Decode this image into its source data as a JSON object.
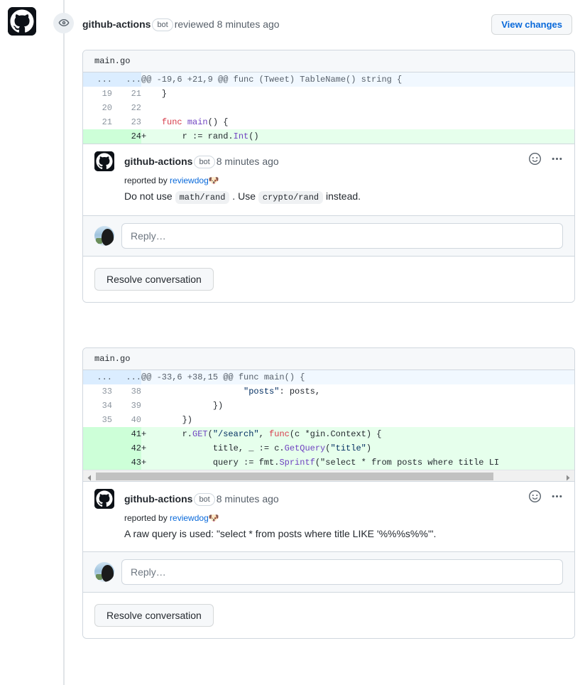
{
  "header": {
    "org_avatar_icon": "github-mark-icon",
    "state_icon": "eye-icon",
    "actor": "github-actions",
    "bot_badge": "bot",
    "action_text": "reviewed 8 minutes ago",
    "view_changes_label": "View changes"
  },
  "colors": {
    "accent_blue": "#0969da",
    "diff_add_bg": "#e6ffec",
    "diff_add_gutter": "#cdffd8",
    "hunk_bg": "#f1f8ff",
    "hunk_gutter": "#dbedff",
    "border": "#d0d7de",
    "muted_text": "#57606a",
    "keyword_red": "#d73a49",
    "function_purple": "#6f42c1",
    "string_blue": "#032f62"
  },
  "threads": [
    {
      "file": "main.go",
      "diff": {
        "hunk_header": "@@ -19,6 +21,9 @@ func (Tweet) TableName() string {",
        "hunk_old_mark": "...",
        "hunk_new_mark": "...",
        "rows": [
          {
            "type": "context",
            "old": "19",
            "new": "21",
            "marker": "",
            "code": "  }"
          },
          {
            "type": "context",
            "old": "20",
            "new": "22",
            "marker": "",
            "code": ""
          },
          {
            "type": "context",
            "old": "21",
            "new": "23",
            "marker": "",
            "code": "  func main() {"
          },
          {
            "type": "add",
            "old": "",
            "new": "24",
            "marker": "+",
            "code": "      r := rand.Int()"
          }
        ]
      },
      "has_scrollbar": false,
      "comment": {
        "avatar_icon": "github-mark-icon",
        "author": "github-actions",
        "bot_badge": "bot",
        "timestamp": "8 minutes ago",
        "reaction_icon": "smiley-icon",
        "menu_icon": "kebab-menu-icon",
        "reported_prefix": "reported by ",
        "reporter": "reviewdog",
        "reporter_emoji": "🐶",
        "message_parts": [
          {
            "kind": "text",
            "text": "Do not use "
          },
          {
            "kind": "code",
            "text": "math/rand"
          },
          {
            "kind": "text",
            "text": " . Use "
          },
          {
            "kind": "code",
            "text": "crypto/rand"
          },
          {
            "kind": "text",
            "text": " instead."
          }
        ]
      },
      "reply_placeholder": "Reply…",
      "resolve_label": "Resolve conversation"
    },
    {
      "file": "main.go",
      "diff": {
        "hunk_header": "@@ -33,6 +38,15 @@ func main() {",
        "hunk_old_mark": "...",
        "hunk_new_mark": "...",
        "rows": [
          {
            "type": "context",
            "old": "33",
            "new": "38",
            "marker": "",
            "code": "                  \"posts\": posts,"
          },
          {
            "type": "context",
            "old": "34",
            "new": "39",
            "marker": "",
            "code": "            })"
          },
          {
            "type": "context",
            "old": "35",
            "new": "40",
            "marker": "",
            "code": "      })"
          },
          {
            "type": "add",
            "old": "",
            "new": "41",
            "marker": "+",
            "code": "      r.GET(\"/search\", func(c *gin.Context) {"
          },
          {
            "type": "add",
            "old": "",
            "new": "42",
            "marker": "+",
            "code": "            title, _ := c.GetQuery(\"title\")"
          },
          {
            "type": "add",
            "old": "",
            "new": "43",
            "marker": "+",
            "code": "            query := fmt.Sprintf(\"select * from posts where title LI"
          }
        ]
      },
      "has_scrollbar": true,
      "comment": {
        "avatar_icon": "github-mark-icon",
        "author": "github-actions",
        "bot_badge": "bot",
        "timestamp": "8 minutes ago",
        "reaction_icon": "smiley-icon",
        "menu_icon": "kebab-menu-icon",
        "reported_prefix": "reported by ",
        "reporter": "reviewdog",
        "reporter_emoji": "🐶",
        "message_parts": [
          {
            "kind": "text",
            "text": "A raw query is used: \"select * from posts where title LIKE '%%%s%%'\"."
          }
        ]
      },
      "reply_placeholder": "Reply…",
      "resolve_label": "Resolve conversation"
    }
  ]
}
